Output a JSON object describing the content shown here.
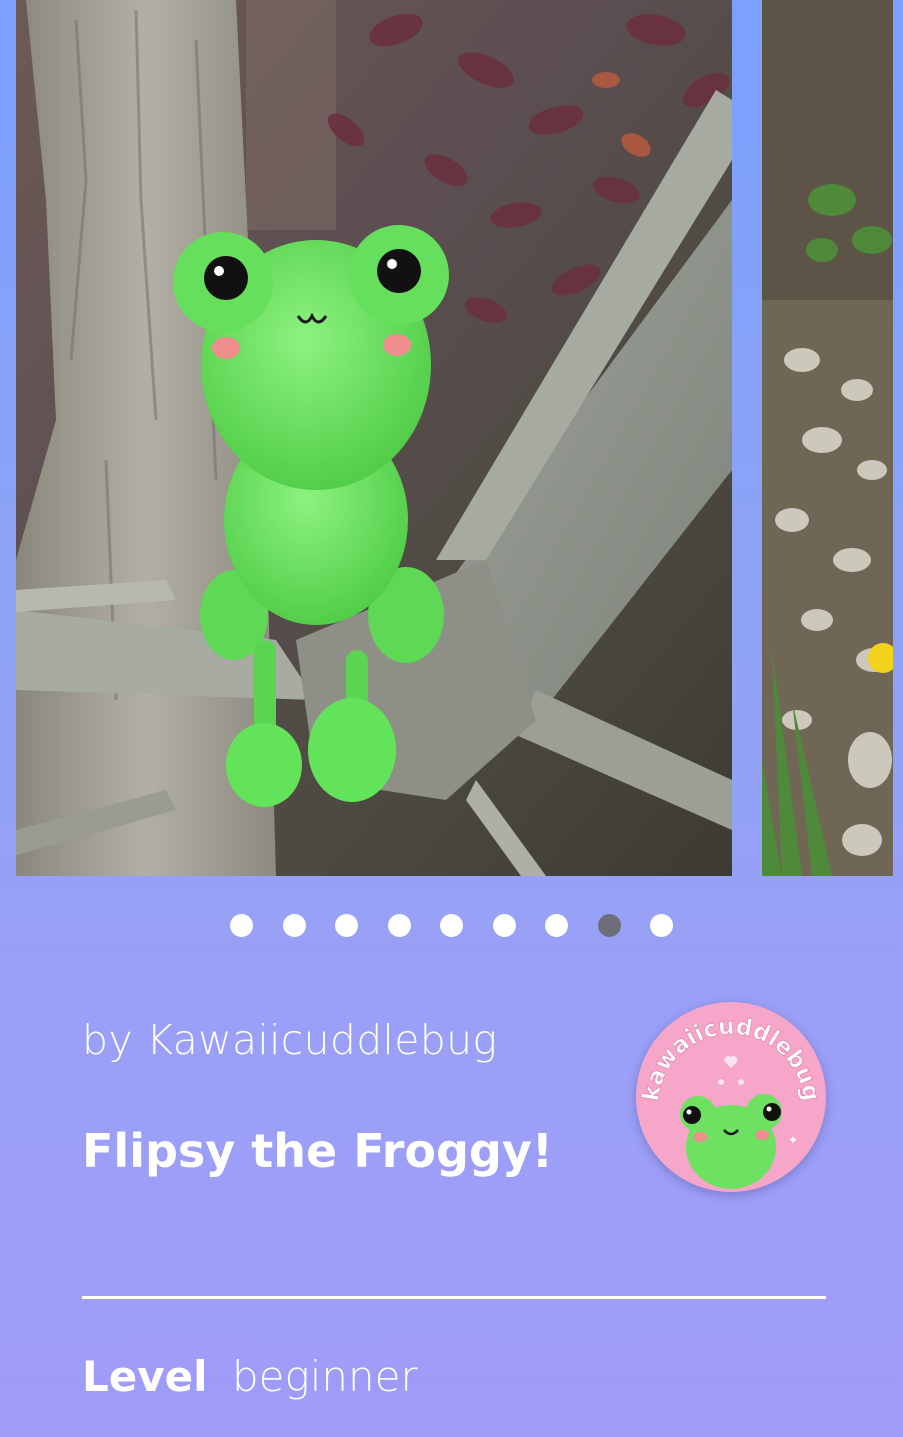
{
  "carousel": {
    "slides": [
      {
        "label": "frog-photo-main"
      },
      {
        "label": "garden-photo-next"
      }
    ],
    "dot_count": 9,
    "active_index": 7,
    "dot_color": "#ffffff",
    "active_dot_color": "#6e6e78"
  },
  "pattern": {
    "author_prefix": "by",
    "author_name": "Kawaiicuddlebug",
    "title": "Flipsy the Froggy!",
    "avatar_text": "kawaiicuddlebug",
    "level_label": "Level",
    "level_value": "beginner"
  },
  "colors": {
    "background_top": "#7ba0ff",
    "background_bottom": "#a09cf9",
    "frog_green": "#63e35a",
    "avatar_pink": "#f6a6c9"
  }
}
